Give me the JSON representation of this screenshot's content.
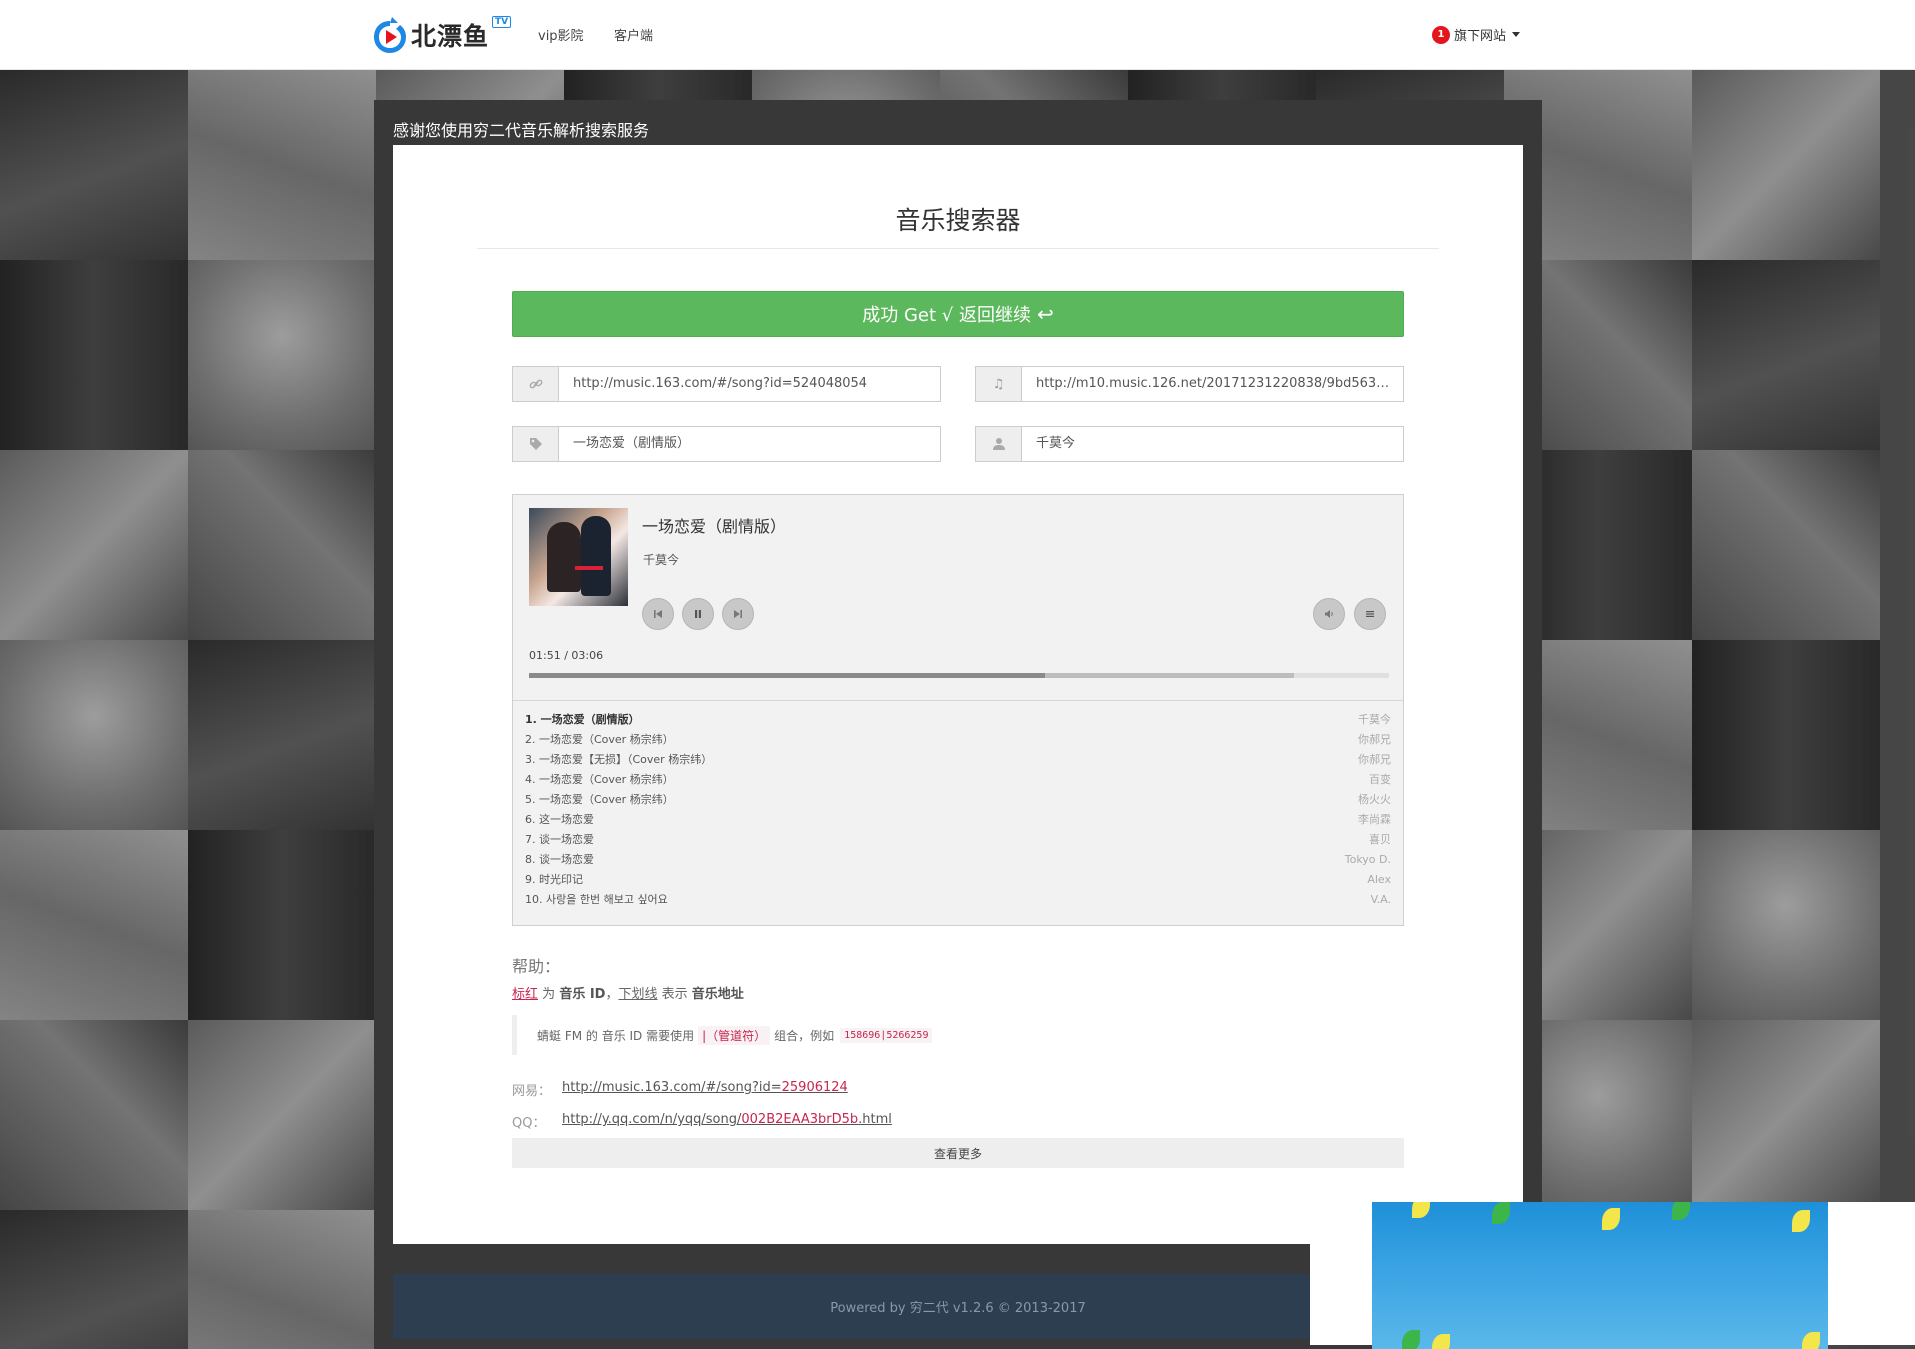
{
  "navbar": {
    "brand": "北漂鱼",
    "brand_badge": "TV",
    "links": [
      "vip影院",
      "客户端"
    ],
    "right_badge": "1",
    "right_label": "旗下网站"
  },
  "panel": {
    "thanks": "感谢您使用穷二代音乐解析搜索服务",
    "title": "音乐搜索器",
    "success_button": "成功 Get √ 返回继续"
  },
  "fields": {
    "song_url": "http://music.163.com/#/song?id=524048054",
    "music_url": "http://m10.music.126.net/20171231220838/9bd56341...",
    "song_name": "一场恋爱（剧情版）",
    "artist": "千莫今"
  },
  "player": {
    "title": "一场恋爱（剧情版）",
    "artist": "千莫今",
    "time": "01:51 / 03:06",
    "progress_played": 0.6,
    "progress_buffered": 0.89,
    "playlist": [
      {
        "name": "1. 一场恋爱（剧情版）",
        "artist": "千莫今"
      },
      {
        "name": "2. 一场恋爱（Cover 杨宗纬）",
        "artist": "你郝兄"
      },
      {
        "name": "3. 一场恋爱【无损】（Cover 杨宗纬）",
        "artist": "你郝兄"
      },
      {
        "name": "4. 一场恋爱（Cover 杨宗纬）",
        "artist": "百变"
      },
      {
        "name": "5. 一场恋爱（Cover 杨宗纬）",
        "artist": "杨火火"
      },
      {
        "name": "6. 这一场恋爱",
        "artist": "李尚霖"
      },
      {
        "name": "7. 谈一场恋爱",
        "artist": "喜贝"
      },
      {
        "name": "8. 谈一场恋爱",
        "artist": "Tokyo D."
      },
      {
        "name": "9. 时光印记",
        "artist": "Alex"
      },
      {
        "name": "10. 사랑을 한번 해보고 싶어요",
        "artist": "V.A."
      }
    ]
  },
  "help": {
    "heading": "帮助：",
    "red_word": "标红",
    "is": "为",
    "music_id": "音乐 ID",
    "comma": "，",
    "underline_word": "下划线",
    "means": "表示",
    "music_url": "音乐地址",
    "note_prefix": "蜻蜓 FM 的 音乐 ID 需要使用",
    "note_kbd": "|（管道符）",
    "note_mid": "组合，例如",
    "note_code": "158696|5266259",
    "netease_label": "网易：",
    "netease_link_prefix": "http://music.163.com/#/song?id=",
    "netease_link_id": "25906124",
    "qq_label": "QQ：",
    "qq_link_prefix": "http://y.qq.com/n/yqq/song/",
    "qq_link_id": "002B2EAA3brD5b",
    "qq_link_suffix": ".html",
    "more_button": "查看更多"
  },
  "footer": {
    "text": "Powered by 穷二代 v1.2.6 © 2013-2017"
  }
}
